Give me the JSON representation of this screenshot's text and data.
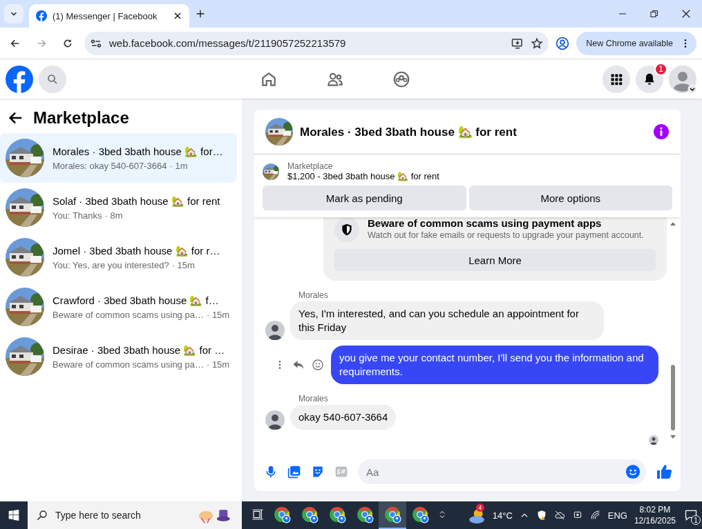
{
  "browser": {
    "tab_title": "(1) Messenger | Facebook",
    "url": "web.facebook.com/messages/t/2119057252213579",
    "update_button": "New Chrome available"
  },
  "top_bar": {
    "notification_count": "1"
  },
  "sidebar": {
    "title": "Marketplace",
    "conversations": [
      {
        "title": "Morales · 3bed 3bath house 🏡 for…",
        "preview": "Morales: okay 540-607-3664",
        "time": "· 1m",
        "selected": true
      },
      {
        "title": "Solaf · 3bed 3bath house 🏡 for rent",
        "preview": "You: Thanks",
        "time": "· 8m",
        "selected": false
      },
      {
        "title": "Jomel · 3bed 3bath house 🏡 for r…",
        "preview": "You: Yes, are you interested?",
        "time": "· 15m",
        "selected": false
      },
      {
        "title": "Crawford · 3bed 3bath house 🏡 f…",
        "preview": "Beware of common scams using pa…",
        "time": "· 15m",
        "selected": false
      },
      {
        "title": "Desirae · 3bed 3bath house 🏡 for …",
        "preview": "Beware of common scams using pa…",
        "time": "· 15m",
        "selected": false
      }
    ]
  },
  "chat": {
    "title": "Morales · 3bed 3bath house 🏡 for rent",
    "listing": {
      "label": "Marketplace",
      "title": "$1,200 - 3bed 3bath house 🏡 for rent",
      "buttons": [
        "Mark as pending",
        "More options"
      ]
    },
    "safety_notice": {
      "title": "Beware of common scams using payment apps",
      "text": "Watch out for fake emails or requests to upgrade your payment account.",
      "button": "Learn More"
    },
    "messages": [
      {
        "kind": "incoming",
        "sender": "Morales",
        "text": "Yes, I'm interested, and can you schedule an appointment for this Friday"
      },
      {
        "kind": "outgoing",
        "text": "you give me your contact number, I'll send you the information and requirements."
      },
      {
        "kind": "incoming",
        "sender": "Morales",
        "text": "okay 540-607-3664"
      }
    ],
    "composer": {
      "placeholder": "Aa"
    }
  },
  "taskbar": {
    "search_placeholder": "Type here to search",
    "apps": [
      {
        "selected": false
      },
      {
        "selected": false
      },
      {
        "selected": false
      },
      {
        "selected": false
      },
      {
        "selected": true
      },
      {
        "selected": false
      }
    ],
    "weather_badge": "4",
    "temperature": "14°C",
    "language": "ENG",
    "time": "8:02 PM",
    "date": "12/16/2025",
    "notification_count": "1"
  }
}
